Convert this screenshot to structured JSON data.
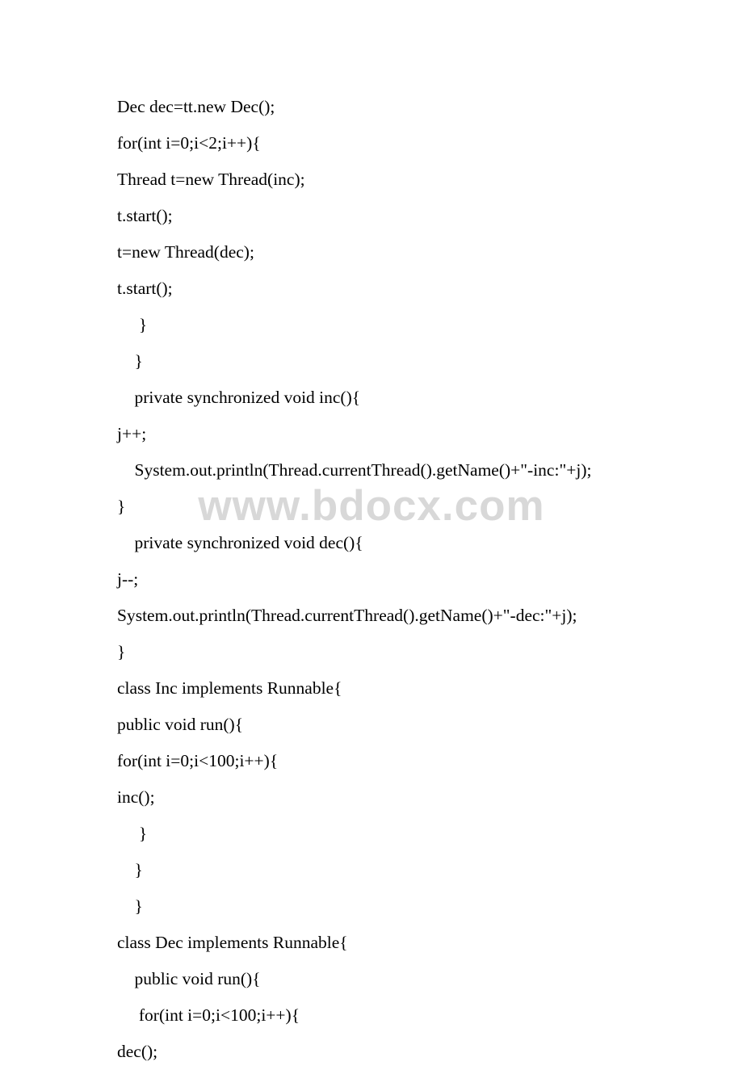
{
  "watermark": "www.bdocx.com",
  "code": {
    "lines": [
      "Dec dec=tt.new Dec();",
      "for(int i=0;i<2;i++){",
      "Thread t=new Thread(inc);",
      "t.start();",
      "t=new Thread(dec);",
      "t.start();",
      "     }",
      "    }",
      "    private synchronized void inc(){",
      "j++;",
      "    System.out.println(Thread.currentThread().getName()+\"-inc:\"+j);",
      "}",
      "    private synchronized void dec(){",
      "j--;",
      "System.out.println(Thread.currentThread().getName()+\"-dec:\"+j);",
      "}",
      "class Inc implements Runnable{",
      "public void run(){",
      "for(int i=0;i<100;i++){",
      "inc();",
      "     }",
      "    }",
      "    }",
      "class Dec implements Runnable{",
      "    public void run(){",
      "     for(int i=0;i<100;i++){",
      "dec();"
    ]
  }
}
